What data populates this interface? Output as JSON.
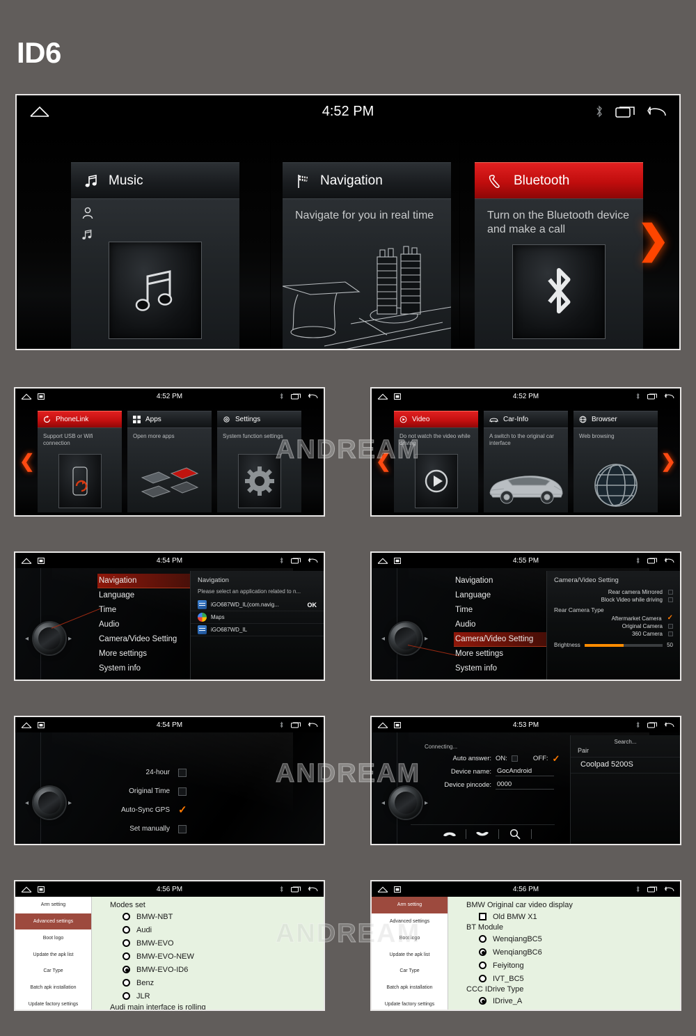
{
  "page": {
    "title": "ID6",
    "watermark": "ANDREAM"
  },
  "colors": {
    "accent_red": "#c00d0d",
    "accent_orange": "#ff4500",
    "background": "#615d5b",
    "green_panel": "#e7f2e1",
    "sidebar_selected": "#9d4a3e"
  },
  "hero": {
    "status": {
      "time": "4:52 PM",
      "home_icon": "home-icon",
      "bluetooth_icon": "bluetooth-icon",
      "recents_icon": "recents-icon",
      "back_icon": "back-icon"
    },
    "tiles": [
      {
        "title": "Music",
        "icon": "music-note-icon",
        "active": false,
        "desc": "",
        "art": "music-note-art"
      },
      {
        "title": "Navigation",
        "icon": "checkered-flag-icon",
        "active": false,
        "desc": "Navigate for you in real time",
        "art": "navigation-3d-art"
      },
      {
        "title": "Bluetooth",
        "icon": "phone-handset-icon",
        "active": true,
        "desc": "Turn on the Bluetooth device and make a call",
        "art": "bluetooth-art"
      }
    ],
    "next_arrow": "❯"
  },
  "row2_left": {
    "status": {
      "time": "4:52 PM"
    },
    "prev_arrow": "❮",
    "tiles": [
      {
        "title": "PhoneLink",
        "icon": "phonelink-icon",
        "active": true,
        "desc": "Support USB or Wifi connection",
        "art": "phone-sync-art"
      },
      {
        "title": "Apps",
        "icon": "grid-icon",
        "active": false,
        "desc": "Open more apps",
        "art": "apps-tiles-art"
      },
      {
        "title": "Settings",
        "icon": "gear-icon",
        "active": false,
        "desc": "System function settings",
        "art": "gear-art"
      }
    ]
  },
  "row2_right": {
    "status": {
      "time": "4:52 PM"
    },
    "prev_arrow": "❮",
    "next_arrow": "❯",
    "tiles": [
      {
        "title": "Video",
        "icon": "play-circle-icon",
        "active": true,
        "desc": "Do not watch the video while driving",
        "art": "play-art"
      },
      {
        "title": "Car-Info",
        "icon": "car-icon",
        "active": false,
        "desc": "A switch to the original car interface",
        "art": "car-art"
      },
      {
        "title": "Browser",
        "icon": "globe-icon",
        "active": false,
        "desc": "Web browsing",
        "art": "globe-art"
      }
    ]
  },
  "row3_left": {
    "status": {
      "time": "4:54 PM"
    },
    "menu": [
      "Navigation",
      "Language",
      "Time",
      "Audio",
      "Camera/Video Setting",
      "More settings",
      "System info"
    ],
    "selected_index": 0,
    "popup": {
      "title": "Navigation",
      "subtitle": "Please select an application related to n...",
      "ok_label": "OK",
      "apps": [
        {
          "name": "iGO687WD_IL(com.navig...",
          "icon": "igo-app-icon",
          "selected": true
        },
        {
          "name": "Maps",
          "icon": "maps-app-icon",
          "selected": false
        },
        {
          "name": "iGO687WD_IL",
          "icon": "igo-app-icon",
          "selected": false
        }
      ]
    }
  },
  "row3_right": {
    "status": {
      "time": "4:55 PM"
    },
    "menu": [
      "Navigation",
      "Language",
      "Time",
      "Audio",
      "Camera/Video Setting",
      "More settings",
      "System info"
    ],
    "selected_index": 4,
    "popup": {
      "title": "Camera/Video Setting",
      "toggles": [
        {
          "label": "Rear camera Mirrored",
          "checked": false
        },
        {
          "label": "Block Video while driving",
          "checked": false
        }
      ],
      "group_title": "Rear Camera Type",
      "camera_types": [
        {
          "label": "Aftermarket Camera",
          "checked": true
        },
        {
          "label": "Original Camera",
          "checked": false
        },
        {
          "label": "360 Camera",
          "checked": false
        }
      ],
      "brightness_label": "Brightness",
      "brightness_value": "50"
    }
  },
  "row4_left": {
    "status": {
      "time": "4:54 PM"
    },
    "options": [
      {
        "label": "24-hour",
        "checked": false
      },
      {
        "label": "Original Time",
        "checked": false
      },
      {
        "label": "Auto-Sync GPS",
        "checked": true
      },
      {
        "label": "Set manually",
        "checked": false
      }
    ]
  },
  "row4_right": {
    "status": {
      "time": "4:53 PM"
    },
    "connecting": "Connecting...",
    "auto_answer_label": "Auto answer:",
    "on_label": "ON:",
    "off_label": "OFF:",
    "on_checked": false,
    "off_checked": true,
    "fields": [
      {
        "label": "Device name:",
        "value": "GocAndroid"
      },
      {
        "label": "Device pincode:",
        "value": "0000"
      }
    ],
    "search_label": "Search...",
    "pair_label": "Pair",
    "device": "Coolpad 5200S",
    "toolbar_icons": [
      "call-answer-icon",
      "call-end-icon",
      "search-icon"
    ]
  },
  "row5_left": {
    "status": {
      "time": "4:56 PM"
    },
    "sidebar": [
      "Arm setting",
      "Advanced settings",
      "Boot logo",
      "Update the apk list",
      "Car Type",
      "Batch apk installation",
      "Update factory settings"
    ],
    "sidebar_selected_index": 1,
    "heading": "Modes set",
    "modes": [
      {
        "label": "BMW-NBT",
        "selected": false
      },
      {
        "label": "Audi",
        "selected": false
      },
      {
        "label": "BMW-EVO",
        "selected": false
      },
      {
        "label": "BMW-EVO-NEW",
        "selected": false
      },
      {
        "label": "BMW-EVO-ID6",
        "selected": true
      },
      {
        "label": "Benz",
        "selected": false
      },
      {
        "label": "JLR",
        "selected": false
      }
    ],
    "footer": "Audi main interface is rolling"
  },
  "row5_right": {
    "status": {
      "time": "4:56 PM"
    },
    "sidebar": [
      "Arm setting",
      "Advanced settings",
      "Boot logo",
      "Update the apk list",
      "Car Type",
      "Batch apk installation",
      "Update factory settings"
    ],
    "sidebar_selected_index": 0,
    "heading1": "BMW Original car video display",
    "checkbox1": {
      "label": "Old BMW X1",
      "checked": false
    },
    "heading2": "BT Module",
    "bt_modules": [
      {
        "label": "WenqiangBC5",
        "selected": false
      },
      {
        "label": "WenqiangBC6",
        "selected": true
      },
      {
        "label": "Feiyitong",
        "selected": false
      },
      {
        "label": "IVT_BC5",
        "selected": false
      }
    ],
    "heading3": "CCC IDrive Type",
    "idrive": [
      {
        "label": "IDrive_A",
        "selected": true
      }
    ]
  }
}
